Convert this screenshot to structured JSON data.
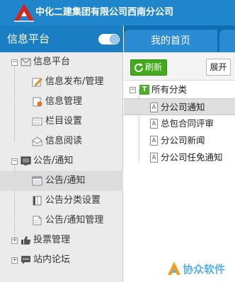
{
  "header": {
    "company": "中化二建集团有限公司西南分公司",
    "colors": {
      "bar": "#1f86cc",
      "logo": "#d8231c"
    }
  },
  "sidebar": {
    "title": "信息平台",
    "toggle_on": true,
    "items": [
      {
        "label": "信息平台",
        "level": 0,
        "icon": "mail-icon",
        "expanded": true
      },
      {
        "label": "信息发布/管理",
        "level": 1,
        "icon": "edit-icon"
      },
      {
        "label": "信息管理",
        "level": 1,
        "icon": "document-gear-icon"
      },
      {
        "label": "栏目设置",
        "level": 1,
        "icon": "columns-icon"
      },
      {
        "label": "信息阅读",
        "level": 1,
        "icon": "envelope-open-icon"
      },
      {
        "label": "公告/通知",
        "level": 0,
        "icon": "monitor-icon",
        "expanded": true
      },
      {
        "label": "公告/通知",
        "level": 1,
        "icon": "window-icon",
        "selected": true
      },
      {
        "label": "公告分类设置",
        "level": 1,
        "icon": "book-icon"
      },
      {
        "label": "公告/通知管理",
        "level": 1,
        "icon": "document-icon"
      },
      {
        "label": "投票管理",
        "level": 0,
        "icon": "thumbs-up-icon",
        "expanded": false
      },
      {
        "label": "站内论坛",
        "level": 0,
        "icon": "chat-icon",
        "expanded": false
      }
    ]
  },
  "main": {
    "tab": "我的首页",
    "toolbar": {
      "refresh_label": "刷新",
      "expand_label": "展开"
    },
    "tree": {
      "root": "所有分类",
      "root_icon_letter": "T",
      "children": [
        {
          "label": "分公司通知",
          "selected": true
        },
        {
          "label": "总包合同评审"
        },
        {
          "label": "分公司新闻"
        },
        {
          "label": "分公司任免通知"
        }
      ]
    }
  },
  "watermark": {
    "text": "协众软件"
  }
}
